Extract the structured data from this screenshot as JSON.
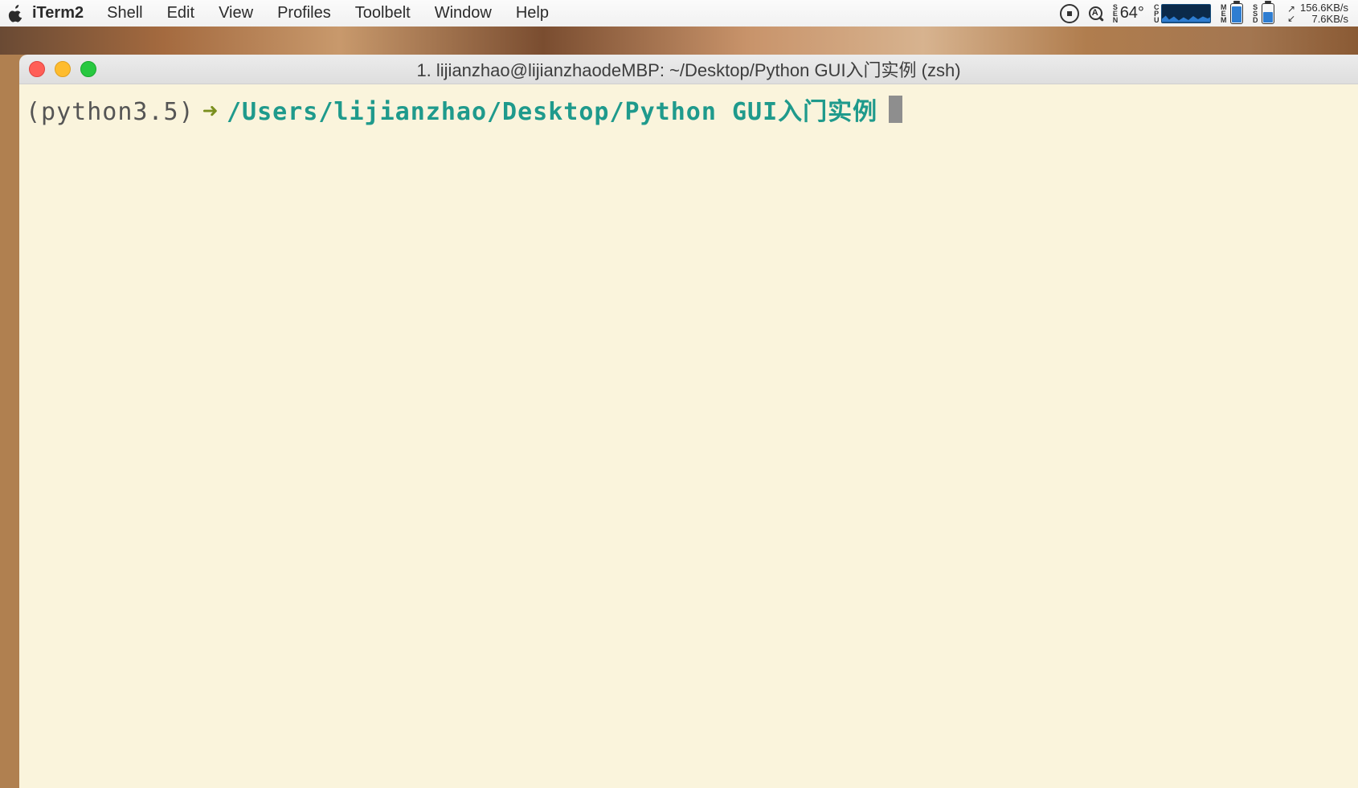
{
  "menubar": {
    "app_name": "iTerm2",
    "items": [
      "Shell",
      "Edit",
      "View",
      "Profiles",
      "Toolbelt",
      "Window",
      "Help"
    ],
    "status": {
      "temperature": "64°",
      "sen_label": "SEN",
      "cpu_label": "CPU",
      "mem_label": "MEM",
      "ssd_label": "SSD",
      "net_up": "156.6KB/s",
      "net_down": "7.6KB/s",
      "arrow_up": "↗",
      "arrow_down": "↙"
    }
  },
  "window": {
    "title": "1. lijianzhao@lijianzhaodeMBP: ~/Desktop/Python GUI入门实例 (zsh)"
  },
  "terminal": {
    "env": "(python3.5)",
    "arrow": "➜",
    "cwd": "/Users/lijianzhao/Desktop/Python GUI入门实例"
  }
}
